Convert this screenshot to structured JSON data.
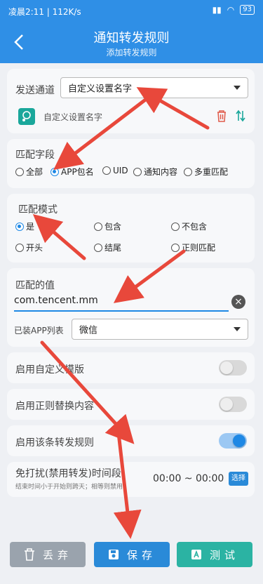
{
  "status": {
    "time": "凌晨2:11 | 112K/s",
    "battery": "93"
  },
  "header": {
    "title": "通知转发规则",
    "subtitle": "添加转发规则"
  },
  "sender": {
    "label": "发送通道",
    "select_value": "自定义设置名字",
    "channel_name": "自定义设置名字"
  },
  "match_field": {
    "label": "匹配字段",
    "options": [
      "全部",
      "APP包名",
      "UID",
      "通知内容",
      "多重匹配"
    ],
    "selected": "APP包名"
  },
  "match_mode": {
    "label": "匹配模式",
    "options": [
      "是",
      "包含",
      "不包含",
      "开头",
      "结尾",
      "正则匹配"
    ],
    "selected": "是"
  },
  "match_value": {
    "label": "匹配的值",
    "value": "com.tencent.mm",
    "apps_label": "已装APP列表",
    "apps_value": "微信"
  },
  "toggles": [
    {
      "label": "启用自定义模版",
      "on": false
    },
    {
      "label": "启用正则替换内容",
      "on": false
    },
    {
      "label": "启用该条转发规则",
      "on": true
    }
  ],
  "dnd": {
    "title": "免打扰(禁用转发)时间段",
    "hint": "结束时间小于开始则跨天；相等则禁用",
    "time": "00:00 ~ 00:00",
    "choose": "选择"
  },
  "buttons": {
    "discard": "丢弃",
    "save": "保存",
    "test": "测试"
  },
  "colors": {
    "primary": "#2f8fe6",
    "discard": "#9aa3ad",
    "save": "#2a8ad8",
    "test": "#2bb3a3",
    "annotation": "#e8483b"
  }
}
